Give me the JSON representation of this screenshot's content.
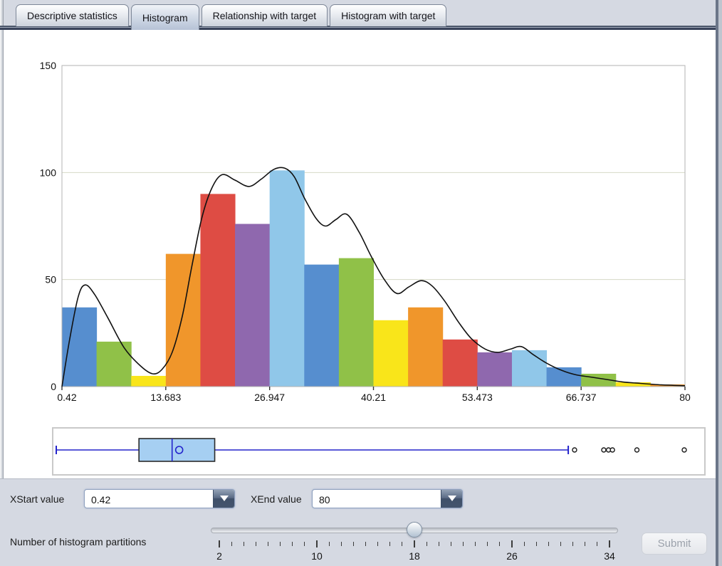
{
  "tabs": [
    {
      "label": "Descriptive statistics",
      "active": false
    },
    {
      "label": "Histogram",
      "active": true
    },
    {
      "label": "Relationship with target",
      "active": false
    },
    {
      "label": "Histogram with target",
      "active": false
    }
  ],
  "controls": {
    "xstart_label": "XStart value",
    "xstart_value": "0.42",
    "xend_label": "XEnd value",
    "xend_value": "80",
    "partitions_label": "Number of histogram partitions",
    "slider": {
      "min": 2,
      "max": 34,
      "value": 18,
      "minor_tick": 1,
      "major_tick": 8,
      "labels": [
        "2",
        "10",
        "18",
        "26",
        "34"
      ]
    },
    "submit_label": "Submit",
    "submit_enabled": false
  },
  "chart_data": [
    {
      "type": "bar",
      "subtype": "histogram",
      "x_start": 0.42,
      "x_end": 80,
      "bins": 18,
      "values": [
        37,
        21,
        5,
        62,
        90,
        76,
        101,
        57,
        60,
        31,
        37,
        22,
        16,
        17,
        9,
        6,
        2,
        1
      ],
      "bar_colors_cycle": [
        "#568ecf",
        "#90c148",
        "#f9e51a",
        "#f0962b",
        "#de4c44",
        "#8f68ae",
        "#90c7e9"
      ],
      "xticks": [
        0.42,
        13.683,
        26.947,
        40.21,
        53.473,
        66.737,
        80
      ],
      "xtick_labels": [
        "0.42",
        "13.683",
        "26.947",
        "40.21",
        "53.473",
        "66.737",
        "80"
      ],
      "yticks": [
        0,
        50,
        100,
        150
      ],
      "ytick_labels": [
        "0",
        "50",
        "100",
        "150"
      ],
      "ylim": [
        0,
        150
      ],
      "grid": true,
      "gridline_color": "#d6dac6",
      "border_color": "#b3b3b3",
      "density_curve": {
        "color": "#111111",
        "points": [
          [
            0.42,
            0
          ],
          [
            1.4,
            22
          ],
          [
            2.5,
            42
          ],
          [
            3.4,
            47.5
          ],
          [
            4.6,
            43
          ],
          [
            6.3,
            32
          ],
          [
            8.4,
            18
          ],
          [
            10.5,
            9.5
          ],
          [
            12.0,
            6
          ],
          [
            13.2,
            8
          ],
          [
            14.5,
            16
          ],
          [
            15.8,
            33
          ],
          [
            17.0,
            56
          ],
          [
            18.3,
            79
          ],
          [
            19.6,
            93
          ],
          [
            20.9,
            99
          ],
          [
            22.5,
            96.5
          ],
          [
            24.3,
            93.5
          ],
          [
            25.9,
            97
          ],
          [
            27.5,
            101.5
          ],
          [
            28.9,
            102
          ],
          [
            30.1,
            98
          ],
          [
            31.4,
            88
          ],
          [
            32.9,
            78.5
          ],
          [
            34.1,
            75
          ],
          [
            35.4,
            78
          ],
          [
            36.8,
            80.5
          ],
          [
            38.4,
            72
          ],
          [
            39.9,
            61
          ],
          [
            41.6,
            50
          ],
          [
            43.2,
            43.5
          ],
          [
            44.7,
            46.5
          ],
          [
            46.3,
            49.5
          ],
          [
            47.7,
            47
          ],
          [
            49.3,
            40
          ],
          [
            51.1,
            30
          ],
          [
            52.7,
            22.5
          ],
          [
            54.5,
            17.5
          ],
          [
            56.1,
            16
          ],
          [
            57.7,
            17.5
          ],
          [
            59.1,
            18.7
          ],
          [
            60.6,
            15
          ],
          [
            62.3,
            11
          ],
          [
            64.3,
            7.5
          ],
          [
            66.1,
            5.5
          ],
          [
            67.9,
            4.5
          ],
          [
            69.7,
            3.5
          ],
          [
            72.0,
            2.2
          ],
          [
            74.3,
            1.5
          ],
          [
            77.0,
            0.8
          ],
          [
            80,
            0.4
          ]
        ]
      }
    },
    {
      "type": "boxplot",
      "xlim": [
        0.42,
        80
      ],
      "min": 0.42,
      "q1": 10.9,
      "median": 15.1,
      "mean": 16.0,
      "q3": 20.5,
      "whisker_high": 65.3,
      "outliers": [
        66.1,
        69.8,
        70.4,
        70.9,
        74.0,
        80
      ],
      "box_fill": "#a6cff2",
      "box_border": "#2b2b2b",
      "line_color": "#2323cc",
      "outlier_color": "#1a1a1a"
    }
  ]
}
